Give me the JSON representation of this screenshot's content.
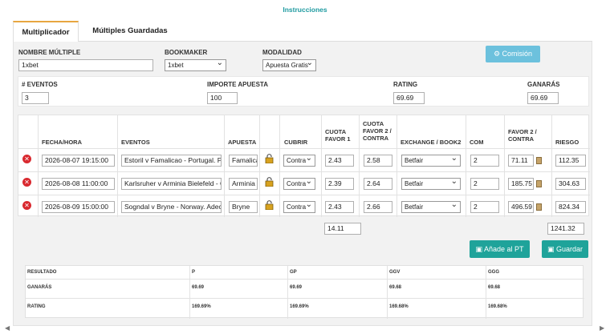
{
  "header": {
    "instrucciones": "Instrucciones"
  },
  "tabs": [
    {
      "label": "Multiplicador",
      "active": true
    },
    {
      "label": "Múltiples Guardadas",
      "active": false
    }
  ],
  "form": {
    "nombre_label": "NOMBRE MÚLTIPLE",
    "nombre_value": "1xbet",
    "bookmaker_label": "BOOKMAKER",
    "bookmaker_value": "1xbet",
    "modalidad_label": "MODALIDAD",
    "modalidad_value": "Apuesta Gratis",
    "comision_label": "Comisión"
  },
  "summary": {
    "eventos_label": "# EVENTOS",
    "eventos_value": "3",
    "importe_label": "IMPORTE APUESTA",
    "importe_value": "100",
    "rating_label": "RATING",
    "rating_value": "69.69",
    "ganaras_label": "GANARÁS",
    "ganaras_value": "69.69"
  },
  "table": {
    "headers": {
      "fecha": "FECHA/HORA",
      "eventos": "EVENTOS",
      "apuesta": "APUESTA",
      "cubrir": "CUBRIR",
      "cuota1": "CUOTA FAVOR 1",
      "cuota2": "CUOTA FAVOR 2 / CONTRA",
      "exchange": "EXCHANGE / BOOK2",
      "com": "COM",
      "favor2": "FAVOR 2 / CONTRA",
      "riesgo": "RIESGO"
    },
    "rows": [
      {
        "fecha": "2026-08-07 19:15:00",
        "evento": "Estoril v Famalicao - Portugal. Pr",
        "apuesta": "Famalica",
        "cubrir": "Contra",
        "cuota1": "2.43",
        "cuota2": "2.58",
        "exchange": "Betfair",
        "com": "2",
        "favor2": "71.11",
        "riesgo": "112.35"
      },
      {
        "fecha": "2026-08-08 11:00:00",
        "evento": "Karlsruher v Arminia Bielefeld - G",
        "apuesta": "Arminia B",
        "cubrir": "Contra",
        "cuota1": "2.39",
        "cuota2": "2.64",
        "exchange": "Betfair",
        "com": "2",
        "favor2": "185.75",
        "riesgo": "304.63"
      },
      {
        "fecha": "2026-08-09 15:00:00",
        "evento": "Sogndal v Bryne - Norway. Adeca",
        "apuesta": "Bryne",
        "cubrir": "Contra",
        "cuota1": "2.43",
        "cuota2": "2.66",
        "exchange": "Betfair",
        "com": "2",
        "favor2": "496.59",
        "riesgo": "824.34"
      }
    ],
    "total_cuota": "14.11",
    "total_riesgo": "1241.32"
  },
  "buttons": {
    "anade_pt": "Añade al PT",
    "guardar": "Guardar"
  },
  "resultado": {
    "headers": [
      "RESULTADO",
      "P",
      "GP",
      "GGV",
      "GGG"
    ],
    "ganaras": [
      "GANARÁS",
      "69.69",
      "69.69",
      "69.68",
      "69.68"
    ],
    "rating": [
      "RATING",
      "169.69%",
      "169.69%",
      "169.68%",
      "169.68%"
    ]
  },
  "colors": {
    "teal": "#1fa39a",
    "accent": "#e8a640",
    "delete": "#d9292f",
    "info": "#6cc1dd"
  }
}
